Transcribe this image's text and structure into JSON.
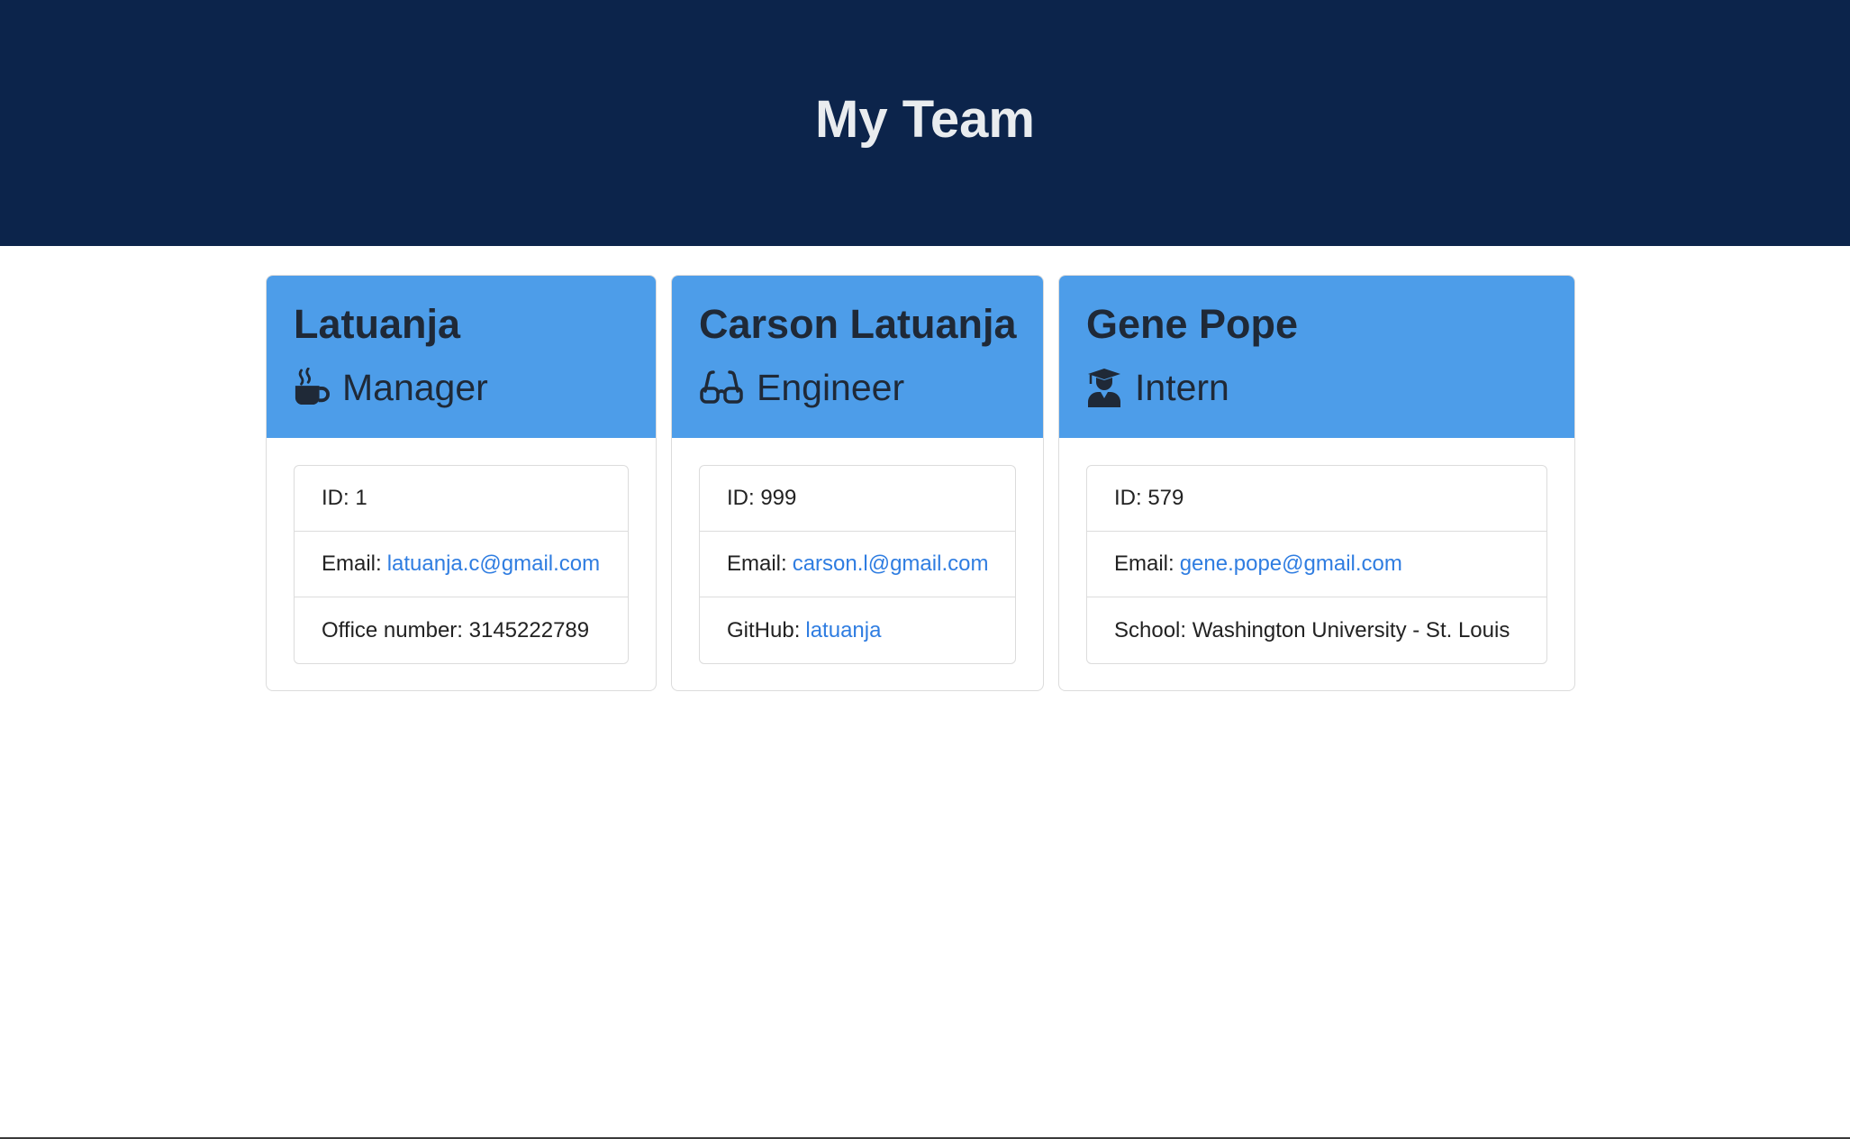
{
  "header": {
    "title": "My Team"
  },
  "team": [
    {
      "name": "Latuanja",
      "role": "Manager",
      "role_icon": "mug-icon",
      "id_label": "ID: 1",
      "email_label": "Email:",
      "email": "latuanja.c@gmail.com",
      "extra_label": "Office number:",
      "extra_value": "3145222789"
    },
    {
      "name": "Carson Latuanja",
      "role": "Engineer",
      "role_icon": "glasses-icon",
      "id_label": "ID: 999",
      "email_label": "Email:",
      "email": "carson.l@gmail.com",
      "extra_label": "GitHub:",
      "extra_value": "latuanja"
    },
    {
      "name": "Gene Pope",
      "role": "Intern",
      "role_icon": "graduate-icon",
      "id_label": "ID: 579",
      "email_label": "Email:",
      "email": "gene.pope@gmail.com",
      "extra_label": "School:",
      "extra_value": "Washington University - St. Louis"
    }
  ],
  "colors": {
    "header_bg": "#0c244b",
    "card_header_bg": "#4d9de9",
    "link": "#2f7de1"
  }
}
